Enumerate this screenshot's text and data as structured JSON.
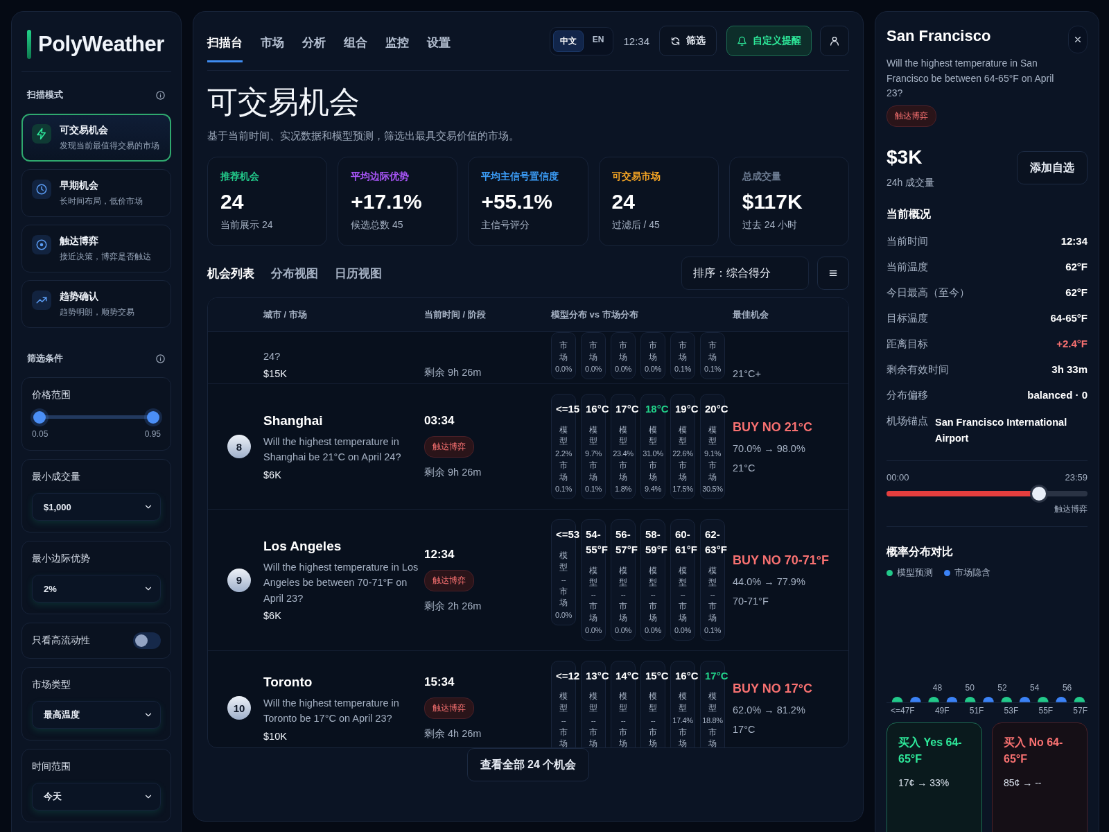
{
  "brand": {
    "name": "PolyWeather"
  },
  "sidebar": {
    "scan_title": "扫描模式",
    "modes": [
      {
        "title": "可交易机会",
        "subtitle": "发现当前最值得交易的市场",
        "selected": true
      },
      {
        "title": "早期机会",
        "subtitle": "长时间布局，低价市场",
        "selected": false
      },
      {
        "title": "触达博弈",
        "subtitle": "接近决策，博弈是否触达",
        "selected": false
      },
      {
        "title": "趋势确认",
        "subtitle": "趋势明朗，顺势交易",
        "selected": false
      }
    ],
    "filter_title": "筛选条件",
    "filters": [
      {
        "kind": "range",
        "label": "价格范围",
        "min": "0.05",
        "max": "0.95",
        "thumbs": [
          {
            "level": 0.05
          },
          {
            "level": 0.95
          }
        ]
      },
      {
        "kind": "select",
        "label": "最小成交量",
        "value": "$1,000"
      },
      {
        "kind": "select",
        "label": "最小边际优势",
        "value": "2%"
      },
      {
        "kind": "toggle",
        "label": "只看高流动性",
        "on": false
      },
      {
        "kind": "select",
        "label": "市场类型",
        "value": "最高温度"
      },
      {
        "kind": "select",
        "label": "时间范围",
        "value": "今天"
      }
    ]
  },
  "header": {
    "tabs": [
      {
        "label": "扫描台",
        "selected": true
      },
      {
        "label": "市场",
        "selected": false
      },
      {
        "label": "分析",
        "selected": false
      },
      {
        "label": "组合",
        "selected": false
      },
      {
        "label": "监控",
        "selected": false
      },
      {
        "label": "设置",
        "selected": false
      }
    ],
    "languages": [
      {
        "label": "中文",
        "selected": true
      },
      {
        "label": "EN",
        "selected": false
      }
    ],
    "time": "12:34",
    "refresh_button": "筛选",
    "alert_button": "自定义提醒"
  },
  "page": {
    "title": "可交易机会",
    "subtitle": "基于当前时间、实况数据和模型预测，筛选出最具交易价值的市场。"
  },
  "stats": [
    {
      "label": "推荐机会",
      "value": "24",
      "note": "当前展示 24",
      "color": "#22c98a"
    },
    {
      "label": "平均边际优势",
      "value": "+17.1%",
      "note": "候选总数 45",
      "color": "#a855f7"
    },
    {
      "label": "平均主信号置信度",
      "value": "+55.1%",
      "note": "主信号评分",
      "color": "#3b9cf6"
    },
    {
      "label": "可交易市场",
      "value": "24",
      "note": "过滤后 / 45",
      "color": "#f5a524"
    },
    {
      "label": "总成交量",
      "value": "$117K",
      "note": "过去 24 小时",
      "color": "#6b7a90"
    }
  ],
  "views": [
    {
      "label": "机会列表",
      "selected": true
    },
    {
      "label": "分布视图",
      "selected": false
    },
    {
      "label": "日历视图",
      "selected": false
    }
  ],
  "sort": "排序：综合得分",
  "table": {
    "columns": [
      "城市 / 市场",
      "当前时间 / 阶段",
      "模型分布 vs 市场分布",
      "最佳机会"
    ],
    "rows": [
      {
        "kind": "partial",
        "question": "24?",
        "volume": "$15K",
        "remaining": "剩余 9h 26m",
        "bins": [
          {
            "market_label": "市场",
            "market": "0.0%"
          },
          {
            "market_label": "市场",
            "market": "0.0%"
          },
          {
            "market_label": "市场",
            "market": "0.0%"
          },
          {
            "market_label": "市场",
            "market": "0.0%"
          },
          {
            "market_label": "市场",
            "market": "0.1%"
          },
          {
            "market_label": "市场",
            "market": "0.1%"
          }
        ],
        "best": {
          "target": "21°C+"
        }
      },
      {
        "kind": "full",
        "rank": "8",
        "city": "Shanghai",
        "question": "Will the highest temperature in Shanghai be 21°C on April 24?",
        "volume": "$6K",
        "time": "03:34",
        "badge": "触达博弈",
        "remaining": "剩余 9h 26m",
        "bins": [
          {
            "label": "<=15",
            "highlighted": false,
            "model_label": "模型",
            "model": "2.2%",
            "market_label": "市场",
            "market": "0.1%"
          },
          {
            "label": "16°C",
            "highlighted": false,
            "model_label": "模型",
            "model": "9.7%",
            "market_label": "市场",
            "market": "0.1%"
          },
          {
            "label": "17°C",
            "highlighted": false,
            "model_label": "模型",
            "model": "23.4%",
            "market_label": "市场",
            "market": "1.8%"
          },
          {
            "label": "18°C",
            "highlighted": true,
            "model_label": "模型",
            "model": "31.0%",
            "market_label": "市场",
            "market": "9.4%"
          },
          {
            "label": "19°C",
            "highlighted": false,
            "model_label": "模型",
            "model": "22.6%",
            "market_label": "市场",
            "market": "17.5%"
          },
          {
            "label": "20°C",
            "highlighted": false,
            "model_label": "模型",
            "model": "9.1%",
            "market_label": "市场",
            "market": "30.5%"
          }
        ],
        "best": {
          "action": "BUY NO 21°C",
          "prob": "70.0% → 98.0%",
          "target": "21°C"
        }
      },
      {
        "kind": "full",
        "rank": "9",
        "city": "Los Angeles",
        "question": "Will the highest temperature in Los Angeles be between 70-71°F on April 23?",
        "volume": "$6K",
        "time": "12:34",
        "badge": "触达博弈",
        "remaining": "剩余 2h 26m",
        "bins": [
          {
            "label": "<=53",
            "highlighted": false,
            "model_label": "模型",
            "model": "--",
            "market_label": "市场",
            "market": "0.0%"
          },
          {
            "label": "54-55°F",
            "highlighted": false,
            "model_label": "模型",
            "model": "--",
            "market_label": "市场",
            "market": "0.0%"
          },
          {
            "label": "56-57°F",
            "highlighted": false,
            "model_label": "模型",
            "model": "--",
            "market_label": "市场",
            "market": "0.0%"
          },
          {
            "label": "58-59°F",
            "highlighted": false,
            "model_label": "模型",
            "model": "--",
            "market_label": "市场",
            "market": "0.0%"
          },
          {
            "label": "60-61°F",
            "highlighted": false,
            "model_label": "模型",
            "model": "--",
            "market_label": "市场",
            "market": "0.0%"
          },
          {
            "label": "62-63°F",
            "highlighted": false,
            "model_label": "模型",
            "model": "--",
            "market_label": "市场",
            "market": "0.1%"
          }
        ],
        "best": {
          "action": "BUY NO 70-71°F",
          "prob": "44.0% → 77.9%",
          "target": "70-71°F"
        }
      },
      {
        "kind": "full",
        "rank": "10",
        "city": "Toronto",
        "question": "Will the highest temperature in Toronto be 17°C on April 23?",
        "volume": "$10K",
        "time": "15:34",
        "badge": "触达博弈",
        "remaining": "剩余 4h 26m",
        "bins": [
          {
            "label": "<=12",
            "highlighted": false,
            "model_label": "模型",
            "model": "--",
            "market_label": "市场"
          },
          {
            "label": "13°C",
            "highlighted": false,
            "model_label": "模型",
            "model": "--",
            "market_label": "市场"
          },
          {
            "label": "14°C",
            "highlighted": false,
            "model_label": "模型",
            "model": "--",
            "market_label": "市场"
          },
          {
            "label": "15°C",
            "highlighted": false,
            "model_label": "模型",
            "model": "--",
            "market_label": "市场"
          },
          {
            "label": "16°C",
            "highlighted": false,
            "model_label": "模型",
            "model": "17.4%",
            "market_label": "市场"
          },
          {
            "label": "17°C",
            "highlighted": true,
            "model_label": "模型",
            "model": "18.8%",
            "market_label": "市场"
          }
        ],
        "best": {
          "action": "BUY NO 17°C",
          "prob": "62.0% → 81.2%",
          "target": "17°C"
        }
      }
    ]
  },
  "view_all_button": "查看全部 24 个机会",
  "detail": {
    "title": "San Francisco",
    "question": "Will the highest temperature in San Francisco be between 64-65°F on April 23?",
    "badge": "触达博弈",
    "volume": "$3K",
    "volume_label": "24h 成交量",
    "watch_button": "添加自选",
    "overview_title": "当前概况",
    "overview": [
      {
        "label": "当前时间",
        "value": "12:34",
        "highlight": false
      },
      {
        "label": "当前温度",
        "value": "62°F",
        "highlight": false
      },
      {
        "label": "今日最高（至今）",
        "value": "62°F",
        "highlight": false
      },
      {
        "label": "目标温度",
        "value": "64-65°F",
        "highlight": false
      },
      {
        "label": "距离目标",
        "value": "+2.4°F",
        "highlight": true
      },
      {
        "label": "剩余有效时间",
        "value": "3h 33m",
        "highlight": false
      },
      {
        "label": "分布偏移",
        "value": "balanced · 0",
        "highlight": false
      },
      {
        "label": "机场锚点",
        "value": "San Francisco International Airport",
        "highlight": false
      }
    ],
    "timeline": {
      "start": "00:00",
      "end": "23:59",
      "level": 0.76,
      "label": "触达博弈"
    },
    "chart_title": "概率分布对比",
    "legend": [
      {
        "label": "模型预测",
        "color": "#22c98a"
      },
      {
        "label": "市场隐含",
        "color": "#3b82f6"
      }
    ],
    "chart_top_labels": [
      "48",
      "50",
      "52",
      "54",
      "56"
    ],
    "chart_axis_labels": [
      "<=47F",
      "49F",
      "51F",
      "53F",
      "55F",
      "57F"
    ],
    "trades": [
      {
        "kind": "yes",
        "title": "买入 Yes 64-65°F",
        "price": "17¢ → 33%"
      },
      {
        "kind": "no",
        "title": "买入 No 64-65°F",
        "price": "85¢ → --"
      }
    ]
  }
}
